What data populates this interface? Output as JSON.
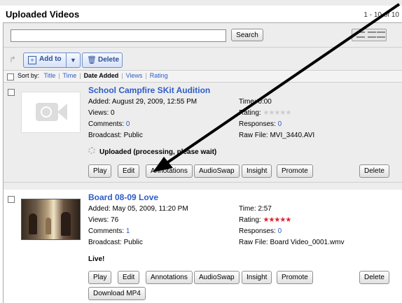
{
  "header": {
    "title": "Uploaded Videos",
    "range": "1 - 10 of 10"
  },
  "search": {
    "value": "",
    "button_label": "Search"
  },
  "toolbar": {
    "add_to_label": "Add to",
    "delete_label": "Delete"
  },
  "sort": {
    "prefix": "Sort by:",
    "options": [
      "Title",
      "Time",
      "Date Added",
      "Views",
      "Rating"
    ],
    "active": "Date Added"
  },
  "videos": [
    {
      "title": "School Campfire SKit Audition",
      "added": "Added: August 29, 2009, 12:55 PM",
      "views": "Views: 0",
      "comments_label": "Comments:",
      "comments_count": "0",
      "broadcast": "Broadcast: Public",
      "time": "Time: 0:00",
      "rating_label": "Rating:",
      "rating_stars": 0,
      "responses_label": "Responses:",
      "responses_count": "0",
      "raw_file": "Raw File: MVI_3440.AVI",
      "status": "Uploaded (processing, please wait)"
    },
    {
      "title": "Board 08-09 Love",
      "added": "Added: May 05, 2009, 11:20 PM",
      "views": "Views: 76",
      "comments_label": "Comments:",
      "comments_count": "1",
      "broadcast": "Broadcast: Public",
      "time": "Time: 2:57",
      "rating_label": "Rating:",
      "rating_stars": 5,
      "responses_label": "Responses:",
      "responses_count": "0",
      "raw_file": "Raw File: Board Video_0001.wmv",
      "status": "Live!"
    }
  ],
  "actions": {
    "play": "Play",
    "edit": "Edit",
    "annotations": "Annotations",
    "audioswap": "AudioSwap",
    "insight": "Insight",
    "promote": "Promote",
    "delete": "Delete",
    "download": "Download MP4"
  },
  "colors": {
    "link": "#2d5cc8",
    "star_on": "#e0202e",
    "star_off": "#cccccc",
    "panel": "#ededed"
  }
}
